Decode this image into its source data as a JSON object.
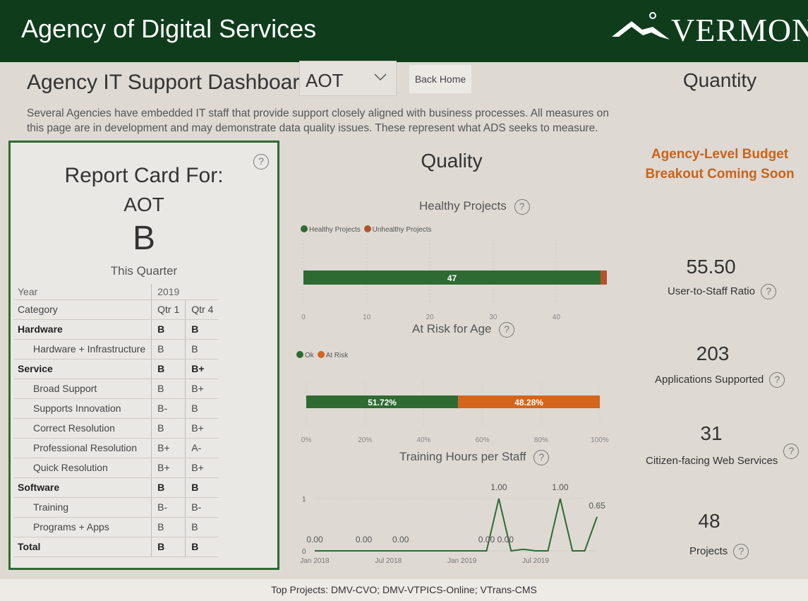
{
  "header": {
    "title": "Agency of Digital Services",
    "logo_text": "VERMONT"
  },
  "dashboard": {
    "title": "Agency IT Support Dashboard for",
    "agency_selected": "AOT",
    "back_button": "Back Home",
    "description": "Several Agencies have embedded IT staff that provide support closely aligned with business processes. All measures on this page are in development and may demonstrate data quality issues. These represent what ADS seeks to measure."
  },
  "report_card": {
    "title": "Report Card For:",
    "agency": "AOT",
    "grade": "B",
    "period_label": "This Quarter",
    "help": "?",
    "table": {
      "year_label": "Year",
      "year": "2019",
      "category_label": "Category",
      "quarters": [
        "Qtr 1",
        "Qtr 4"
      ],
      "rows": [
        {
          "name": "Hardware",
          "q1": "B",
          "q4": "B",
          "bold": true
        },
        {
          "name": "Hardware + Infrastructure",
          "q1": "B",
          "q4": "B",
          "bold": false
        },
        {
          "name": "Service",
          "q1": "B",
          "q4": "B+",
          "bold": true
        },
        {
          "name": "Broad Support",
          "q1": "B",
          "q4": "B+",
          "bold": false
        },
        {
          "name": "Supports Innovation",
          "q1": "B-",
          "q4": "B",
          "bold": false
        },
        {
          "name": "Correct Resolution",
          "q1": "B",
          "q4": "B+",
          "bold": false
        },
        {
          "name": "Professional Resolution",
          "q1": "B+",
          "q4": "A-",
          "bold": false
        },
        {
          "name": "Quick Resolution",
          "q1": "B+",
          "q4": "B+",
          "bold": false
        },
        {
          "name": "Software",
          "q1": "B",
          "q4": "B",
          "bold": true
        },
        {
          "name": "Training",
          "q1": "B-",
          "q4": "B-",
          "bold": false
        },
        {
          "name": "Programs + Apps",
          "q1": "B",
          "q4": "B",
          "bold": false
        },
        {
          "name": "Total",
          "q1": "B",
          "q4": "B",
          "bold": true
        }
      ]
    }
  },
  "quality": {
    "title": "Quality",
    "help": "?",
    "healthy": {
      "title": "Healthy Projects",
      "legend": [
        "Healthy Projects",
        "Unhealthy Projects"
      ],
      "colors": [
        "#2e6b32",
        "#b5532e"
      ],
      "values": [
        47,
        1
      ],
      "ticks": [
        "0",
        "10",
        "20",
        "30",
        "40"
      ],
      "label": "47"
    },
    "risk": {
      "title": "At Risk for Age",
      "legend": [
        "Ok",
        "At Risk"
      ],
      "colors": [
        "#2e6b32",
        "#d3651c"
      ],
      "values": [
        51.72,
        48.28
      ],
      "labels": [
        "51.72%",
        "48.28%"
      ],
      "ticks": [
        "0%",
        "20%",
        "40%",
        "60%",
        "80%",
        "100%"
      ]
    },
    "training": {
      "title": "Training Hours per Staff",
      "y_ticks": [
        "0",
        "1"
      ],
      "x_ticks": [
        "Jan 2018",
        "Jul 2018",
        "Jan 2019",
        "Jul 2019"
      ],
      "point_labels": [
        "0.00",
        "0.00",
        "0.00",
        "0.00",
        "0.00",
        "1.00",
        "1.00",
        "0.65"
      ]
    }
  },
  "quantity": {
    "title": "Quantity",
    "budget_text": "Agency-Level Budget Breakout Coming Soon",
    "metrics": [
      {
        "value": "55.50",
        "label": "User-to-Staff Ratio"
      },
      {
        "value": "203",
        "label": "Applications Supported"
      },
      {
        "value": "31",
        "label": "Citizen-facing Web Services"
      },
      {
        "value": "48",
        "label": "Projects"
      }
    ]
  },
  "footer": {
    "text": "Top Projects: DMV-CVO; DMV-VTPICS-Online; VTrans-CMS"
  },
  "chart_data": [
    {
      "type": "bar",
      "title": "Healthy Projects",
      "categories": [
        ""
      ],
      "series": [
        {
          "name": "Healthy Projects",
          "values": [
            47
          ]
        },
        {
          "name": "Unhealthy Projects",
          "values": [
            1
          ]
        }
      ],
      "xlim": [
        0,
        48
      ]
    },
    {
      "type": "bar",
      "title": "At Risk for Age",
      "categories": [
        ""
      ],
      "series": [
        {
          "name": "Ok",
          "values": [
            51.72
          ]
        },
        {
          "name": "At Risk",
          "values": [
            48.28
          ]
        }
      ],
      "xlim": [
        0,
        100
      ]
    },
    {
      "type": "line",
      "title": "Training Hours per Staff",
      "x": [
        "2018-01",
        "2018-02",
        "2018-03",
        "2018-04",
        "2018-05",
        "2018-06",
        "2018-07",
        "2018-08",
        "2018-09",
        "2018-10",
        "2018-11",
        "2018-12",
        "2019-01",
        "2019-02",
        "2019-03",
        "2019-04",
        "2019-05",
        "2019-06",
        "2019-07",
        "2019-08",
        "2019-09",
        "2019-10",
        "2019-11",
        "2019-12"
      ],
      "series": [
        {
          "values": [
            0,
            0,
            0,
            0,
            0,
            0,
            0,
            0,
            0,
            0,
            0,
            0,
            0,
            0,
            0,
            1.0,
            0,
            0.03,
            0,
            0,
            1.0,
            0,
            0,
            0.65
          ]
        }
      ],
      "ylim": [
        0,
        1.0
      ]
    }
  ]
}
